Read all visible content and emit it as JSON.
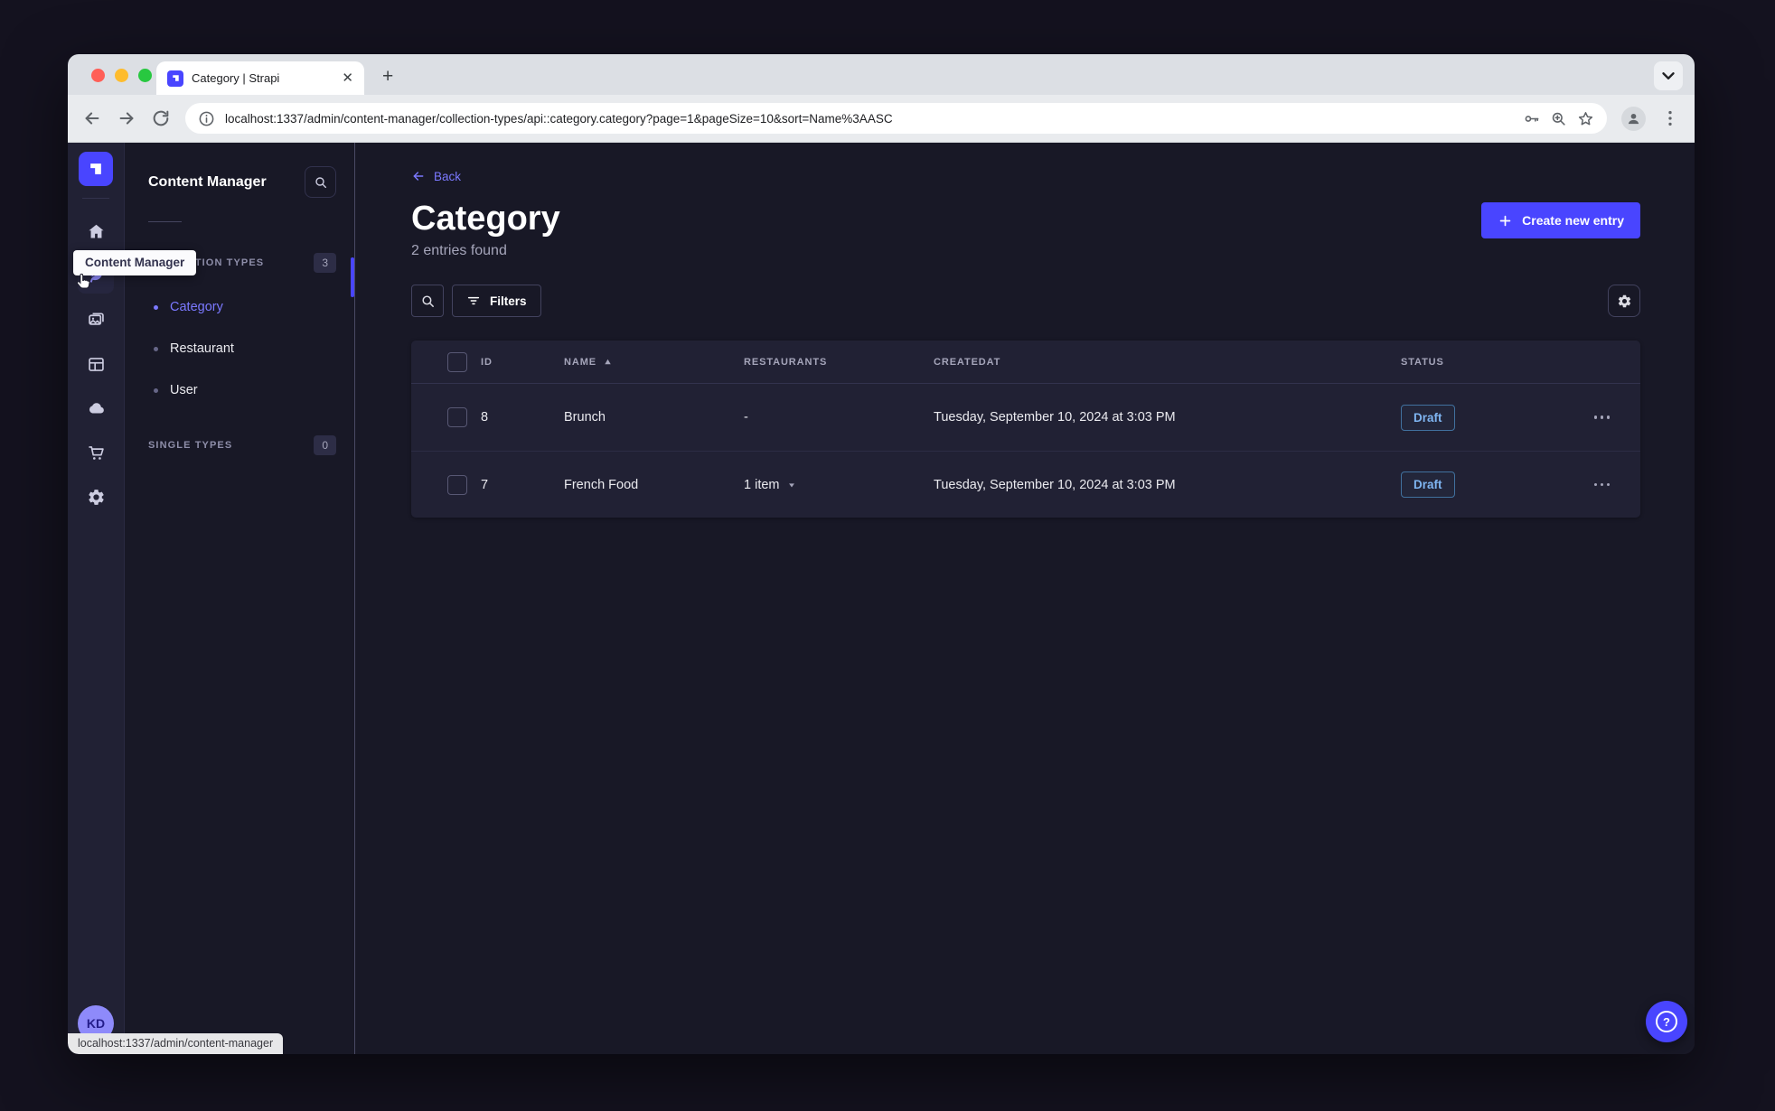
{
  "browser": {
    "tab_title": "Category | Strapi",
    "url": "localhost:1337/admin/content-manager/collection-types/api::category.category?page=1&pageSize=10&sort=Name%3AASC",
    "status_link": "localhost:1337/admin/content-manager"
  },
  "nav": {
    "tooltip": "Content Manager",
    "user_initials": "KD",
    "help_label": "?"
  },
  "subnav": {
    "title": "Content Manager",
    "collection_types": {
      "label": "COLLECTION TYPES",
      "count": "3",
      "items": [
        {
          "label": "Category",
          "active": true
        },
        {
          "label": "Restaurant",
          "active": false
        },
        {
          "label": "User",
          "active": false
        }
      ]
    },
    "single_types": {
      "label": "SINGLE TYPES",
      "count": "0"
    }
  },
  "main": {
    "back_label": "Back",
    "title": "Category",
    "subtitle": "2 entries found",
    "create_button_label": "Create new entry",
    "filters_button_label": "Filters",
    "table": {
      "columns": {
        "id": "ID",
        "name": "NAME",
        "restaurants": "RESTAURANTS",
        "createdat": "CREATEDAT",
        "status": "STATUS"
      },
      "rows": [
        {
          "id": "8",
          "name": "Brunch",
          "restaurants": "-",
          "createdat": "Tuesday, September 10, 2024 at 3:03 PM",
          "status": "Draft"
        },
        {
          "id": "7",
          "name": "French Food",
          "restaurants": "1 item",
          "createdat": "Tuesday, September 10, 2024 at 3:03 PM",
          "status": "Draft"
        }
      ]
    }
  },
  "colors": {
    "primary": "#4945ff",
    "primary_light": "#7b79ff",
    "draft_text": "#7fb5f1"
  }
}
